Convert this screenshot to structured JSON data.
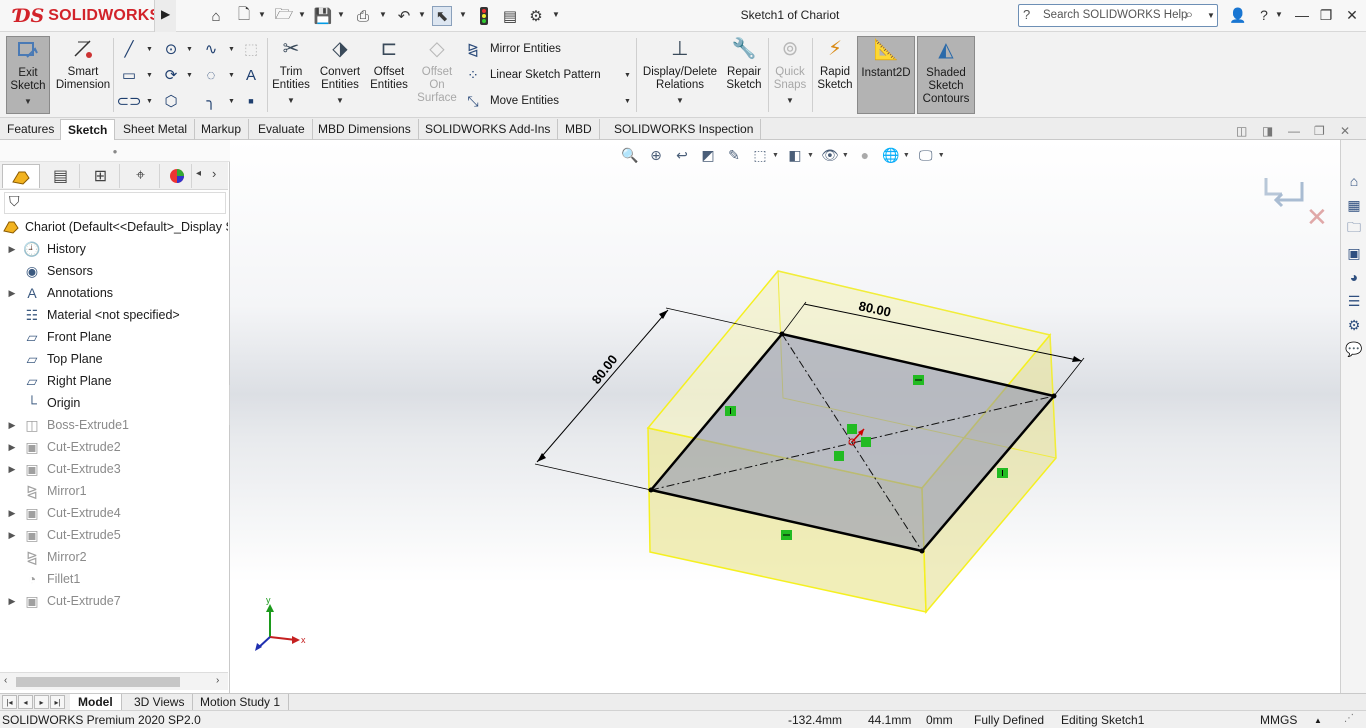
{
  "app": {
    "logo_text": "SOLIDWORKS",
    "window_title": "Sketch1 of Chariot"
  },
  "search": {
    "placeholder": "Search SOLIDWORKS Help"
  },
  "quick_access": {
    "icons": [
      "home-icon",
      "new-document-icon",
      "open-icon",
      "save-icon",
      "print-icon",
      "undo-icon",
      "select-icon",
      "rebuild-icon",
      "file-properties-icon",
      "options-icon"
    ]
  },
  "ribbon": {
    "exit_sketch": "Exit Sketch",
    "smart_dimension": "Smart Dimension",
    "trim_entities": "Trim Entities",
    "convert_entities": "Convert Entities",
    "offset_entities": "Offset Entities",
    "offset_on_surface": "Offset On Surface",
    "mirror_entities": "Mirror Entities",
    "linear_sketch_pattern": "Linear Sketch Pattern",
    "move_entities": "Move Entities",
    "display_delete_relations": "Display/Delete Relations",
    "repair_sketch": "Repair Sketch",
    "quick_snaps": "Quick Snaps",
    "rapid_sketch": "Rapid Sketch",
    "instant2d": "Instant2D",
    "shaded_sketch_contours": "Shaded Sketch Contours"
  },
  "command_tabs": [
    {
      "label": "Features",
      "active": false
    },
    {
      "label": "Sketch",
      "active": true
    },
    {
      "label": "Sheet Metal",
      "active": false
    },
    {
      "label": "Markup",
      "active": false
    },
    {
      "label": "Evaluate",
      "active": false
    },
    {
      "label": "MBD Dimensions",
      "active": false
    },
    {
      "label": "SOLIDWORKS Add-Ins",
      "active": false
    },
    {
      "label": "MBD",
      "active": false
    },
    {
      "label": "SOLIDWORKS Inspection",
      "active": false
    }
  ],
  "feature_tree": {
    "root": "Chariot  (Default<<Default>_Display S",
    "items": [
      {
        "label": "History",
        "icon": "history-icon",
        "expandable": true,
        "suppressed": false
      },
      {
        "label": "Sensors",
        "icon": "sensors-icon",
        "expandable": false,
        "suppressed": false
      },
      {
        "label": "Annotations",
        "icon": "annotations-icon",
        "expandable": true,
        "suppressed": false
      },
      {
        "label": "Material <not specified>",
        "icon": "material-icon",
        "expandable": false,
        "suppressed": false
      },
      {
        "label": "Front Plane",
        "icon": "plane-icon",
        "expandable": false,
        "suppressed": false
      },
      {
        "label": "Top Plane",
        "icon": "plane-icon",
        "expandable": false,
        "suppressed": false
      },
      {
        "label": "Right Plane",
        "icon": "plane-icon",
        "expandable": false,
        "suppressed": false
      },
      {
        "label": "Origin",
        "icon": "origin-icon",
        "expandable": false,
        "suppressed": false
      },
      {
        "label": "Boss-Extrude1",
        "icon": "extrude-icon",
        "expandable": true,
        "suppressed": true
      },
      {
        "label": "Cut-Extrude2",
        "icon": "cut-extrude-icon",
        "expandable": true,
        "suppressed": true
      },
      {
        "label": "Cut-Extrude3",
        "icon": "cut-extrude-icon",
        "expandable": true,
        "suppressed": true
      },
      {
        "label": "Mirror1",
        "icon": "mirror-icon",
        "expandable": false,
        "suppressed": true
      },
      {
        "label": "Cut-Extrude4",
        "icon": "cut-extrude-icon",
        "expandable": true,
        "suppressed": true
      },
      {
        "label": "Cut-Extrude5",
        "icon": "cut-extrude-icon",
        "expandable": true,
        "suppressed": true
      },
      {
        "label": "Mirror2",
        "icon": "mirror-icon",
        "expandable": false,
        "suppressed": true
      },
      {
        "label": "Fillet1",
        "icon": "fillet-icon",
        "expandable": false,
        "suppressed": true
      },
      {
        "label": "Cut-Extrude7",
        "icon": "cut-extrude-icon",
        "expandable": true,
        "suppressed": true
      }
    ]
  },
  "viewport": {
    "dimension_1": "80.00",
    "dimension_2": "80.00",
    "triad_x": "x",
    "triad_y": "y",
    "colors": {
      "part_fill": "#f2f0b4",
      "part_edge": "#ffff33",
      "sketch_line": "#000000",
      "relation_marker": "#22bb22"
    }
  },
  "bottom_tabs": [
    {
      "label": "Model",
      "active": true
    },
    {
      "label": "3D Views",
      "active": false
    },
    {
      "label": "Motion Study 1",
      "active": false
    }
  ],
  "status": {
    "product": "SOLIDWORKS Premium 2020 SP2.0",
    "x": "-132.4mm",
    "y": "44.1mm",
    "z": "0mm",
    "state": "Fully Defined",
    "editing": "Editing Sketch1",
    "units": "MMGS"
  }
}
